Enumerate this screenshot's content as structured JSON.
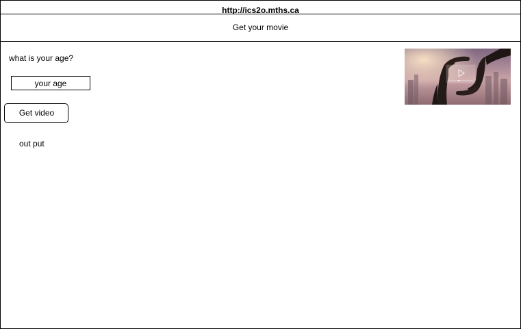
{
  "browser": {
    "url": "http://ics2o.mths.ca"
  },
  "header": {
    "title": "Get your movie"
  },
  "form": {
    "question": "what is your age?",
    "age_placeholder": "your age",
    "age_value": "",
    "submit_label": "Get video"
  },
  "result": {
    "output_text": "out put"
  },
  "thumbnail": {
    "description_icon": "play-icon",
    "colors": {
      "sky_top": "#8a6f86",
      "sky_mid": "#c7a0a6",
      "glow": "#f5d7b8",
      "hands": "#1e1614",
      "screen": "#e9d0c4"
    }
  }
}
